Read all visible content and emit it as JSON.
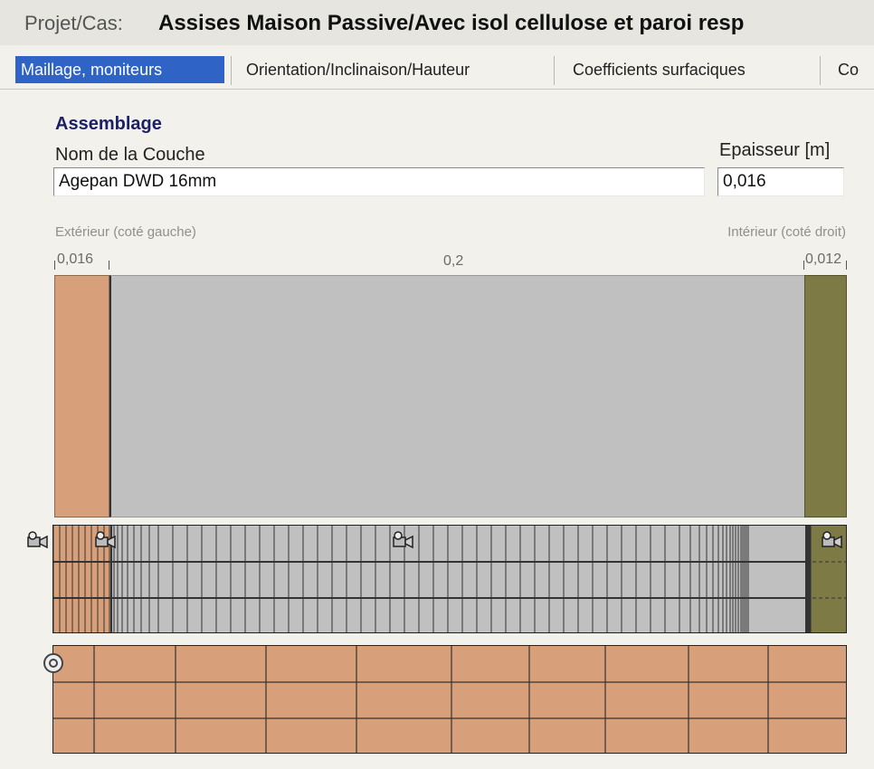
{
  "window": {
    "title_label": "Projet/Cas:",
    "title_value": "Assises Maison Passive/Avec isol cellulose et paroi resp"
  },
  "tabs": [
    {
      "label": "Maillage, moniteurs",
      "active": true
    },
    {
      "label": "Orientation/Inclinaison/Hauteur",
      "active": false
    },
    {
      "label": "Coefficients surfaciques",
      "active": false
    },
    {
      "label": "Co",
      "active": false
    }
  ],
  "assembly": {
    "section_title": "Assemblage",
    "layer_name_label": "Nom de la Couche",
    "layer_name_value": "Agepan DWD 16mm",
    "thickness_label": "Epaisseur [m]",
    "thickness_value": "0,016",
    "exterior_label": "Extérieur (coté gauche)",
    "interior_label": "Intérieur (coté droit)"
  },
  "layers": [
    {
      "thickness": "0,016",
      "color": "#d8a07a"
    },
    {
      "thickness": "0,2",
      "color": "#c0c0c0"
    },
    {
      "thickness": "0,012",
      "color": "#7d7a45"
    }
  ],
  "colors": {
    "active_tab": "#2f63c6",
    "section_title": "#1b1f66",
    "second_mesh": "#d8a07a"
  },
  "icons": {
    "monitor": "monitor-sensor-icon",
    "ring": "ring-target-icon"
  }
}
